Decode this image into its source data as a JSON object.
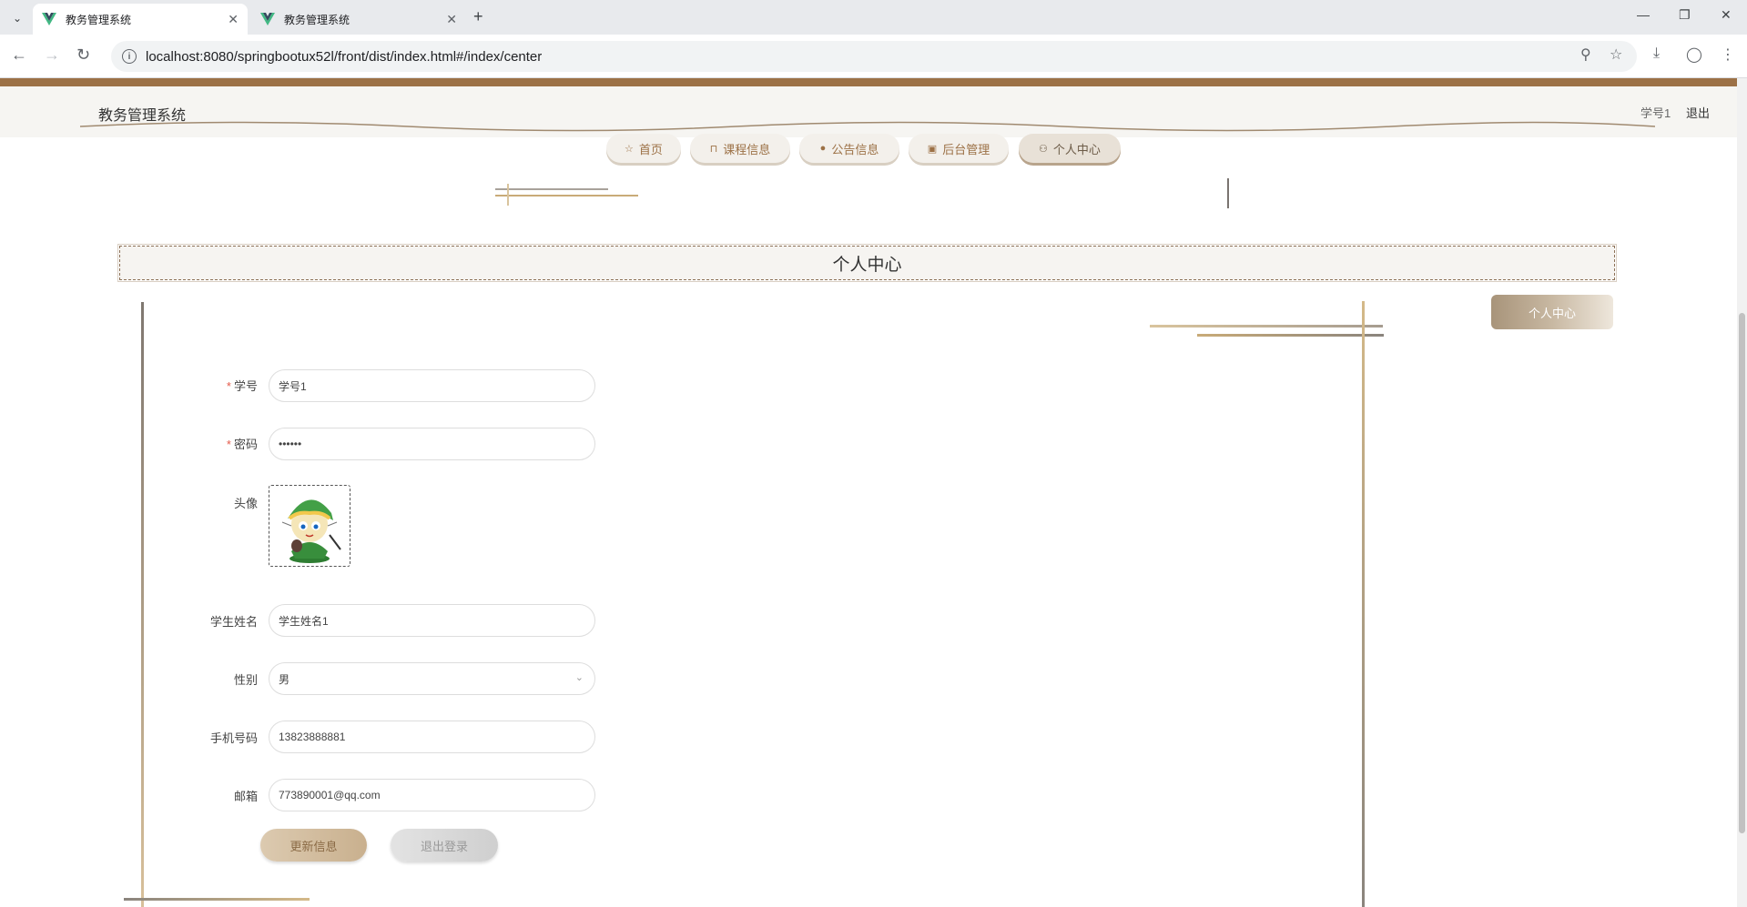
{
  "browser": {
    "tabs": [
      {
        "title": "教务管理系统",
        "active": true
      },
      {
        "title": "教务管理系统",
        "active": false
      }
    ],
    "url": "localhost:8080/springbootux52l/front/dist/index.html#/index/center"
  },
  "header": {
    "site_title": "教务管理系统",
    "username": "学号1",
    "logout": "退出"
  },
  "nav": {
    "items": [
      {
        "label": "首页",
        "icon": "star-icon"
      },
      {
        "label": "课程信息",
        "icon": "bag-icon"
      },
      {
        "label": "公告信息",
        "icon": "info-icon"
      },
      {
        "label": "后台管理",
        "icon": "admin-icon"
      },
      {
        "label": "个人中心",
        "icon": "user-icon",
        "active": true
      }
    ]
  },
  "section": {
    "title": "个人中心",
    "side_button": "个人中心"
  },
  "form": {
    "student_no": {
      "label": "学号",
      "value": "学号1",
      "required": true
    },
    "password": {
      "label": "密码",
      "value": "••••••",
      "required": true
    },
    "avatar": {
      "label": "头像"
    },
    "student_name": {
      "label": "学生姓名",
      "value": "学生姓名1"
    },
    "gender": {
      "label": "性别",
      "value": "男"
    },
    "phone": {
      "label": "手机号码",
      "value": "13823888881"
    },
    "email": {
      "label": "邮箱",
      "value": "773890001@qq.com"
    }
  },
  "buttons": {
    "update": "更新信息",
    "logout": "退出登录"
  },
  "colors": {
    "accent": "#9c7146",
    "header_bg": "#f6f5f2",
    "required": "#e45a4a"
  }
}
